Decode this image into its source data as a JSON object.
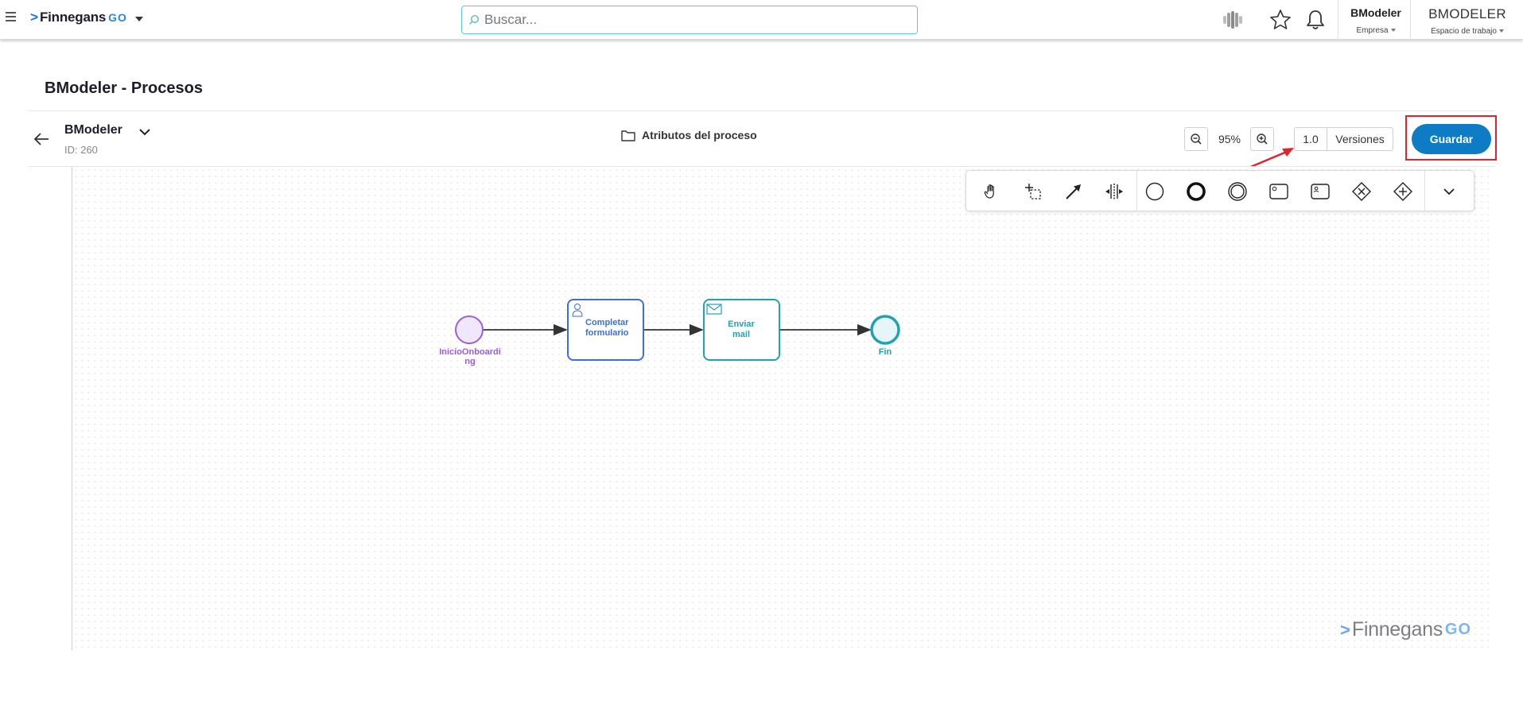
{
  "topbar": {
    "brand": "Finnegans",
    "brand_suffix": "GO",
    "search_placeholder": "Buscar...",
    "company_name": "BModeler",
    "company_label": "Empresa",
    "workspace_name": "BMODELER",
    "workspace_label": "Espacio de trabajo"
  },
  "page": {
    "title": "BModeler - Procesos"
  },
  "model": {
    "name": "BModeler",
    "id_label": "ID: 260"
  },
  "toolbar": {
    "attributes_label": "Atributos del proceso",
    "zoom_value": "95%",
    "version_number": "1.0",
    "versions_label": "Versiones",
    "save_label": "Guardar"
  },
  "palette": {
    "tools": [
      "hand-tool-icon",
      "lasso-tool-icon",
      "connect-tool-icon",
      "space-tool-icon",
      "start-event-icon",
      "end-event-icon",
      "intermediate-event-icon",
      "task-icon",
      "user-task-icon",
      "exclusive-gateway-icon",
      "parallel-gateway-icon",
      "more-chevron-icon"
    ]
  },
  "diagram": {
    "start_event": "InicioOnboarding",
    "task_1": "Completar formulario",
    "task_2": "Enviar mail",
    "end_event": "Fin"
  },
  "watermark": {
    "brand": "Finnegans",
    "suffix": "GO"
  },
  "colors": {
    "accent": "#0e7cc4",
    "highlight": "#e0242c",
    "start_event": "#9c5ce6",
    "user_task": "#3a6fe0",
    "send_task": "#20a2b3"
  }
}
